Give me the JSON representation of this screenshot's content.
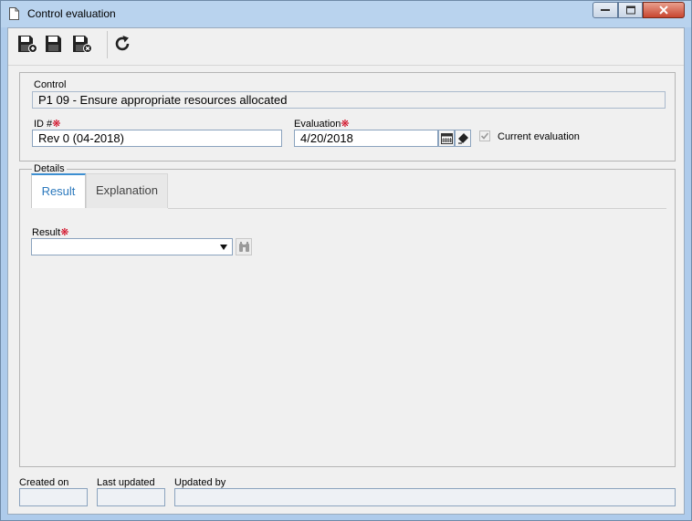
{
  "window": {
    "title": "Control evaluation"
  },
  "toolbar": {
    "buttons": [
      {
        "name": "save-and-new-icon"
      },
      {
        "name": "save-icon"
      },
      {
        "name": "save-and-close-icon"
      },
      {
        "name": "refresh-icon"
      }
    ]
  },
  "header": {
    "control_label": "Control",
    "control_value": "P1 09 - Ensure appropriate resources allocated",
    "id_label": "ID #",
    "id_value": "Rev 0 (04-2018)",
    "evaluation_label": "Evaluation",
    "evaluation_value": "4/20/2018",
    "current_evaluation_label": "Current evaluation",
    "current_evaluation_checked": true
  },
  "details": {
    "legend": "Details",
    "tabs": [
      {
        "label": "Result",
        "active": true
      },
      {
        "label": "Explanation",
        "active": false
      }
    ],
    "result_label": "Result",
    "result_value": ""
  },
  "footer": {
    "created_on_label": "Created on",
    "created_on_value": "",
    "last_updated_label": "Last updated",
    "last_updated_value": "",
    "updated_by_label": "Updated by",
    "updated_by_value": ""
  },
  "required_marker": "❋",
  "colors": {
    "accent": "#3d8fd1",
    "required": "#d0021b",
    "titlebar": "#b9d3ee"
  }
}
